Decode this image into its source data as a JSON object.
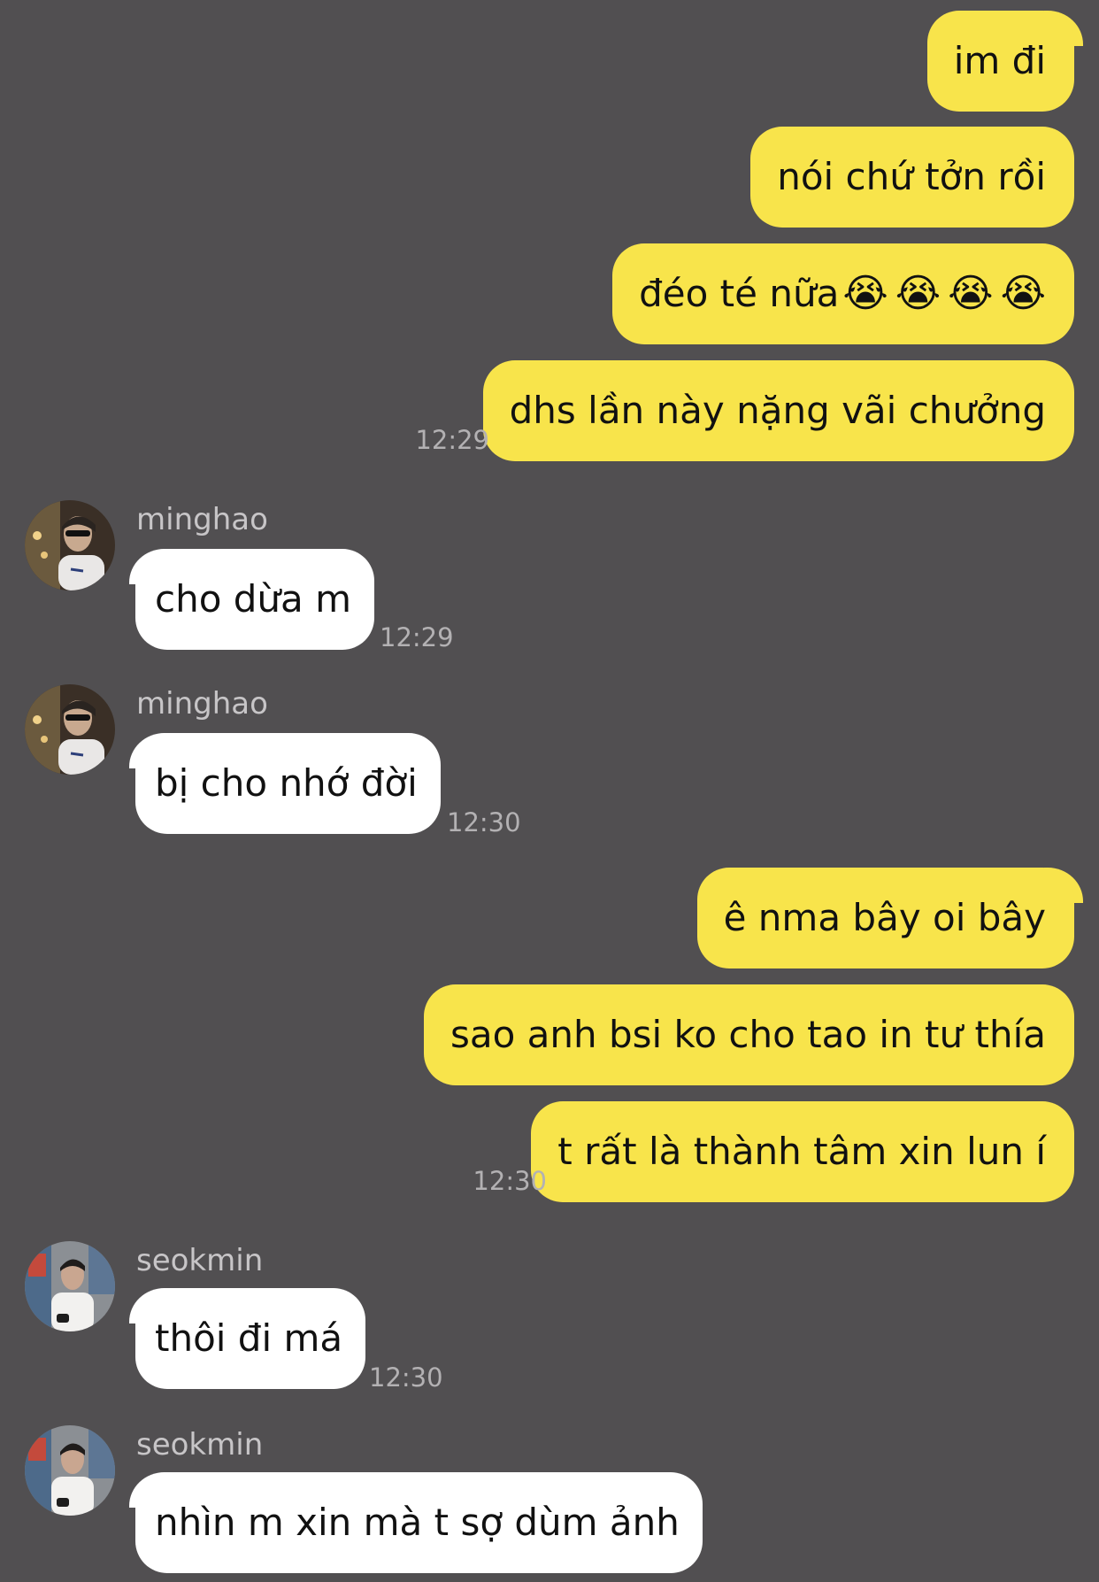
{
  "messages": [
    {
      "side": "out",
      "text": "im đi"
    },
    {
      "side": "out",
      "text": "nói chứ tởn rồi"
    },
    {
      "side": "out",
      "text": "đéo té nữa",
      "emoji": [
        "😭",
        "😭",
        "😭",
        "😭"
      ],
      "emoji_name": "loudly-crying-face-icon"
    },
    {
      "side": "out",
      "text": "dhs lần này nặng vãi chưởng",
      "time": "12:29"
    },
    {
      "side": "in",
      "sender": "minghao",
      "text": "cho dừa m",
      "time": "12:29"
    },
    {
      "side": "in",
      "sender": "minghao",
      "text": "bị cho nhớ đời",
      "time": "12:30"
    },
    {
      "side": "out",
      "text": "ê nma bây oi bây"
    },
    {
      "side": "out",
      "text": "sao anh bsi ko cho tao in tư thía"
    },
    {
      "side": "out",
      "text": "t rất là thành tâm xin lun í",
      "time": "12:30"
    },
    {
      "side": "in",
      "sender": "seokmin",
      "text": "thôi đi má",
      "time": "12:30"
    },
    {
      "side": "in",
      "sender": "seokmin",
      "text": "nhìn m xin mà t sợ dùm ảnh"
    }
  ],
  "colors": {
    "background": "#514f51",
    "outgoing_bubble": "#f8e44b",
    "incoming_bubble": "#ffffff",
    "timestamp": "#b3b1b3",
    "sender_name": "#c7c5c7"
  }
}
